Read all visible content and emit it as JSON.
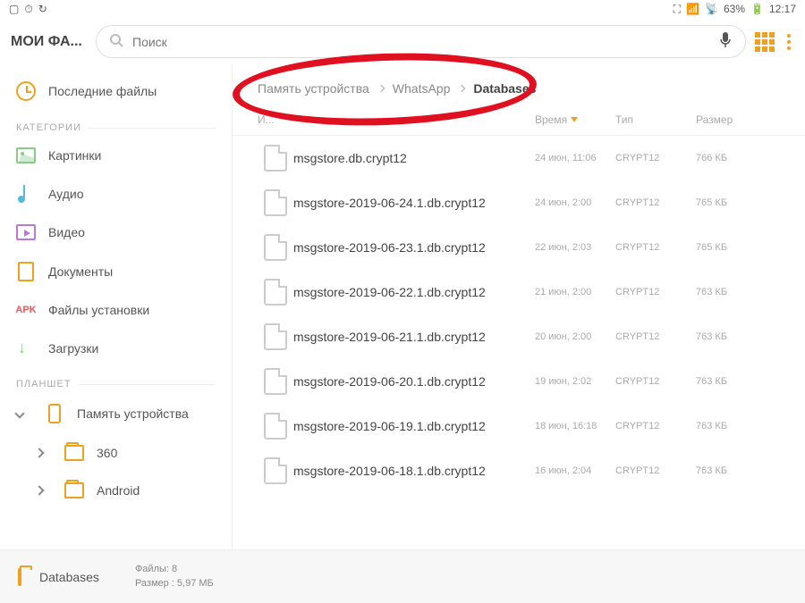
{
  "statusbar": {
    "battery": "63%",
    "time": "12:17"
  },
  "app_title": "МОИ ФА...",
  "search_placeholder": "Поиск",
  "sidebar": {
    "recent": "Последние файлы",
    "cat_header": "КАТЕГОРИИ",
    "images": "Картинки",
    "audio": "Аудио",
    "video": "Видео",
    "documents": "Документы",
    "apk": "Файлы установки",
    "downloads": "Загрузки",
    "tablet_header": "ПЛАНШЕТ",
    "device_storage": "Память устройства",
    "folder_360": "360",
    "folder_android": "Android"
  },
  "breadcrumb": [
    "Память устройства",
    "WhatsApp",
    "Databases"
  ],
  "columns": {
    "name_partial": "И...",
    "time": "Время",
    "type": "Тип",
    "size": "Размер"
  },
  "files": [
    {
      "name": "msgstore.db.crypt12",
      "time": "24 июн, 11:06",
      "type": "CRYPT12",
      "size": "766 КБ"
    },
    {
      "name": "msgstore-2019-06-24.1.db.crypt12",
      "time": "24 июн, 2:00",
      "type": "CRYPT12",
      "size": "765 КБ"
    },
    {
      "name": "msgstore-2019-06-23.1.db.crypt12",
      "time": "22 июн, 2:03",
      "type": "CRYPT12",
      "size": "765 КБ"
    },
    {
      "name": "msgstore-2019-06-22.1.db.crypt12",
      "time": "21 июн, 2:00",
      "type": "CRYPT12",
      "size": "763 КБ"
    },
    {
      "name": "msgstore-2019-06-21.1.db.crypt12",
      "time": "20 июн, 2:00",
      "type": "CRYPT12",
      "size": "763 КБ"
    },
    {
      "name": "msgstore-2019-06-20.1.db.crypt12",
      "time": "19 июн, 2:02",
      "type": "CRYPT12",
      "size": "763 КБ"
    },
    {
      "name": "msgstore-2019-06-19.1.db.crypt12",
      "time": "18 июн, 16:18",
      "type": "CRYPT12",
      "size": "763 КБ"
    },
    {
      "name": "msgstore-2019-06-18.1.db.crypt12",
      "time": "16 июн, 2:04",
      "type": "CRYPT12",
      "size": "763 КБ"
    }
  ],
  "footer": {
    "folder_name": "Databases",
    "files_label": "Файлы: 8",
    "size_label": "Размер : 5,97 МБ"
  }
}
